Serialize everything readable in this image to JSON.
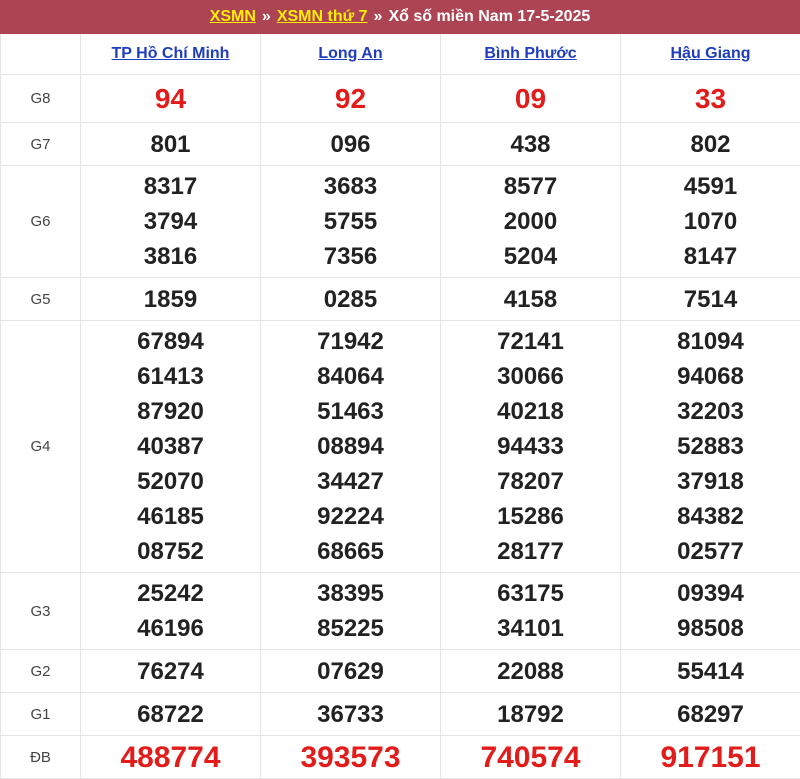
{
  "header": {
    "link1": "XSMN",
    "sep1": "»",
    "link2": "XSMN thứ 7",
    "sep2": "»",
    "title": "Xổ số miền Nam 17-5-2025"
  },
  "provinces": [
    "TP Hồ Chí Minh",
    "Long An",
    "Bình Phước",
    "Hậu Giang"
  ],
  "prizes": [
    {
      "label": "G8",
      "values": [
        [
          "94"
        ],
        [
          "92"
        ],
        [
          "09"
        ],
        [
          "33"
        ]
      ]
    },
    {
      "label": "G7",
      "values": [
        [
          "801"
        ],
        [
          "096"
        ],
        [
          "438"
        ],
        [
          "802"
        ]
      ]
    },
    {
      "label": "G6",
      "values": [
        [
          "8317",
          "3794",
          "3816"
        ],
        [
          "3683",
          "5755",
          "7356"
        ],
        [
          "8577",
          "2000",
          "5204"
        ],
        [
          "4591",
          "1070",
          "8147"
        ]
      ]
    },
    {
      "label": "G5",
      "values": [
        [
          "1859"
        ],
        [
          "0285"
        ],
        [
          "4158"
        ],
        [
          "7514"
        ]
      ]
    },
    {
      "label": "G4",
      "values": [
        [
          "67894",
          "61413",
          "87920",
          "40387",
          "52070",
          "46185",
          "08752"
        ],
        [
          "71942",
          "84064",
          "51463",
          "08894",
          "34427",
          "92224",
          "68665"
        ],
        [
          "72141",
          "30066",
          "40218",
          "94433",
          "78207",
          "15286",
          "28177"
        ],
        [
          "81094",
          "94068",
          "32203",
          "52883",
          "37918",
          "84382",
          "02577"
        ]
      ]
    },
    {
      "label": "G3",
      "values": [
        [
          "25242",
          "46196"
        ],
        [
          "38395",
          "85225"
        ],
        [
          "63175",
          "34101"
        ],
        [
          "09394",
          "98508"
        ]
      ]
    },
    {
      "label": "G2",
      "values": [
        [
          "76274"
        ],
        [
          "07629"
        ],
        [
          "22088"
        ],
        [
          "55414"
        ]
      ]
    },
    {
      "label": "G1",
      "values": [
        [
          "68722"
        ],
        [
          "36733"
        ],
        [
          "18792"
        ],
        [
          "68297"
        ]
      ]
    },
    {
      "label": "ĐB",
      "values": [
        [
          "488774"
        ],
        [
          "393573"
        ],
        [
          "740574"
        ],
        [
          "917151"
        ]
      ]
    }
  ],
  "colors": {
    "header_bg": "#ad4453",
    "header_link": "#ffee00",
    "province_link": "#1f3dbd",
    "highlight_number": "#e21b1b"
  }
}
